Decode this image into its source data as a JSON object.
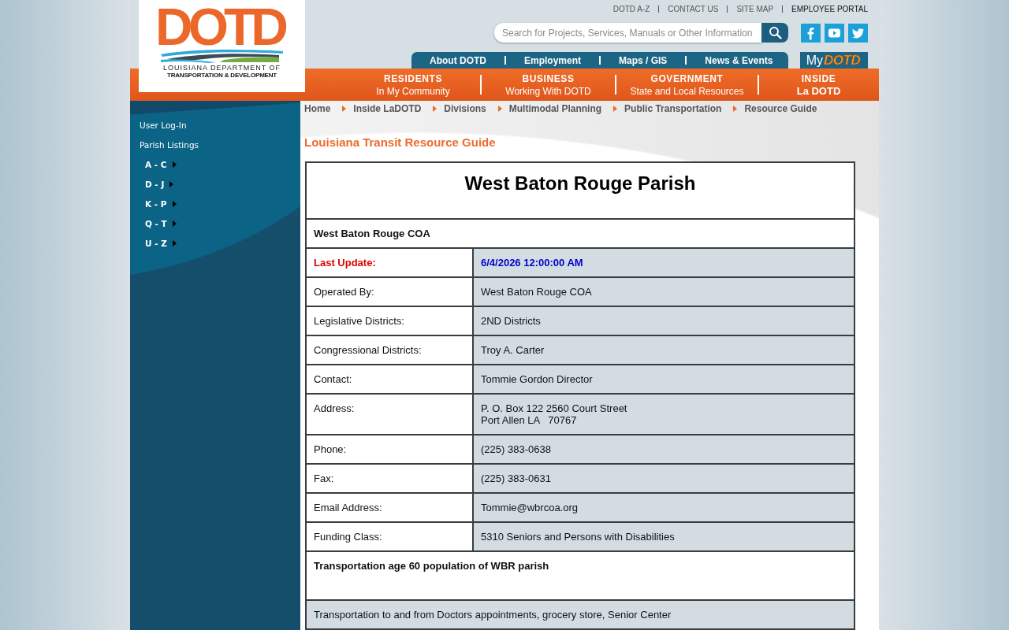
{
  "header": {
    "logo": {
      "wordmark": "DOTD",
      "line_1": "LOUISIANA DEPARTMENT OF",
      "line_2": "TRANSPORTATION & DEVELOPMENT"
    },
    "top_links": [
      {
        "label": "DOTD A-Z",
        "kind": "plain"
      },
      {
        "label": "CONTACT US",
        "kind": "plain"
      },
      {
        "label": "SITE MAP",
        "kind": "plain"
      },
      {
        "label": "EMPLOYEE PORTAL",
        "kind": "dark"
      }
    ],
    "search": {
      "placeholder": "Search for Projects, Services, Manuals or Other Information"
    },
    "social": [
      {
        "kind": "facebook"
      },
      {
        "kind": "youtube"
      },
      {
        "kind": "twitter"
      }
    ],
    "secondary_nav": [
      "About DOTD",
      "Employment",
      "Maps / GIS",
      "News & Events"
    ],
    "my_dotd": {
      "prefix": "My",
      "brand": "DOTD"
    }
  },
  "main_nav": [
    {
      "label": "RESIDENTS",
      "sub": "In My Community",
      "kind": "plain"
    },
    {
      "label": "BUSINESS",
      "sub": "Working With DOTD",
      "kind": "plain"
    },
    {
      "label": "GOVERNMENT",
      "sub": "State and Local Resources",
      "kind": "plain"
    },
    {
      "label": "INSIDE",
      "sub": "La DOTD",
      "kind": "strong"
    }
  ],
  "sidebar": {
    "items": [
      {
        "label": "User Log-In"
      },
      {
        "label": "Parish Listings",
        "children": [
          {
            "label": "A - C"
          },
          {
            "label": "D - J"
          },
          {
            "label": "K - P"
          },
          {
            "label": "Q - T"
          },
          {
            "label": "U - Z"
          }
        ]
      }
    ]
  },
  "breadcrumb": [
    "Home",
    "Inside LaDOTD",
    "Divisions",
    "Multimodal Planning",
    "Public Transportation",
    "Resource Guide"
  ],
  "page_title": "Louisiana Transit Resource Guide",
  "table": {
    "title": "West Baton Rouge Parish",
    "agency": "West Baton Rouge COA",
    "fields": [
      {
        "label": "Last Update:",
        "value": "6/4/2026 12:00:00 AM",
        "kind": "update"
      },
      {
        "label": "Operated By:",
        "value": "West Baton Rouge COA",
        "kind": "field"
      },
      {
        "label": "Legislative Districts:",
        "value": "2ND Districts",
        "kind": "field"
      },
      {
        "label": "Congressional Districts:",
        "value": "Troy A. Carter",
        "kind": "field"
      },
      {
        "label": "Contact:",
        "value": "Tommie Gordon Director",
        "kind": "field"
      },
      {
        "label": "Address:",
        "value": "P. O. Box 122 2560 Court Street\nPort Allen LA   70767",
        "kind": "field"
      },
      {
        "label": "Phone:",
        "value": "(225) 383-0638",
        "kind": "field"
      },
      {
        "label": "Fax:",
        "value": "(225) 383-0631",
        "kind": "field"
      },
      {
        "label": "Email Address:",
        "value": "Tommie@wbrcoa.org",
        "kind": "field"
      },
      {
        "label": "Funding Class:",
        "value": "5310 Seniors and Persons with Disabilities",
        "kind": "field"
      }
    ],
    "notes": [
      {
        "text": "Transportation age 60 population of WBR parish",
        "kind": "heading"
      },
      {
        "text": "Transportation to and from Doctors appointments, grocery store, Senior Center",
        "kind": "body"
      }
    ]
  }
}
